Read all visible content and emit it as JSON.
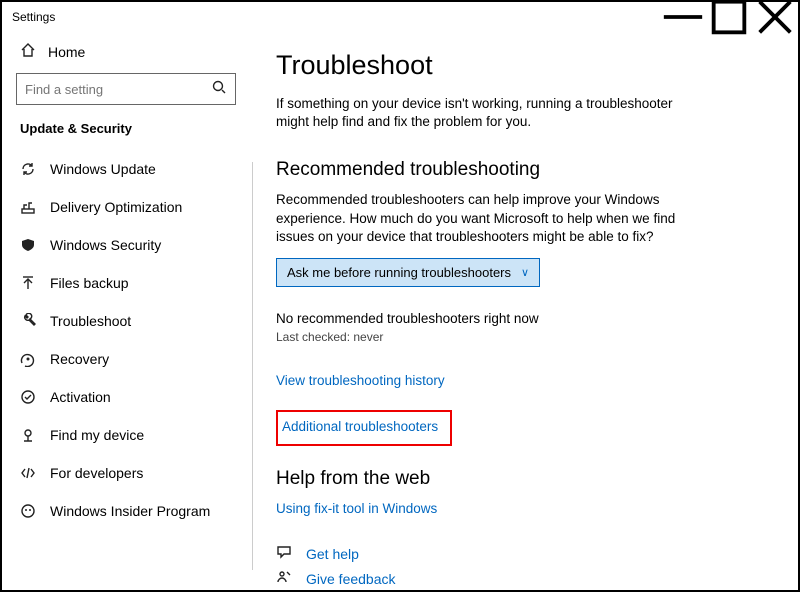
{
  "window": {
    "title": "Settings"
  },
  "sidebar": {
    "home": "Home",
    "search_placeholder": "Find a setting",
    "heading": "Update & Security",
    "items": [
      {
        "label": "Windows Update"
      },
      {
        "label": "Delivery Optimization"
      },
      {
        "label": "Windows Security"
      },
      {
        "label": "Files backup"
      },
      {
        "label": "Troubleshoot"
      },
      {
        "label": "Recovery"
      },
      {
        "label": "Activation"
      },
      {
        "label": "Find my device"
      },
      {
        "label": "For developers"
      },
      {
        "label": "Windows Insider Program"
      }
    ]
  },
  "main": {
    "title": "Troubleshoot",
    "intro": "If something on your device isn't working, running a troubleshooter might help find and fix the problem for you.",
    "recommended": {
      "heading": "Recommended troubleshooting",
      "body": "Recommended troubleshooters can help improve your Windows experience. How much do you want Microsoft to help when we find issues on your device that troubleshooters might be able to fix?",
      "dropdown_value": "Ask me before running troubleshooters",
      "status": "No recommended troubleshooters right now",
      "last_checked": "Last checked: never"
    },
    "links": {
      "history": "View troubleshooting history",
      "additional": "Additional troubleshooters"
    },
    "help": {
      "heading": "Help from the web",
      "fixit": "Using fix-it tool in Windows",
      "get_help": "Get help",
      "feedback": "Give feedback"
    }
  }
}
